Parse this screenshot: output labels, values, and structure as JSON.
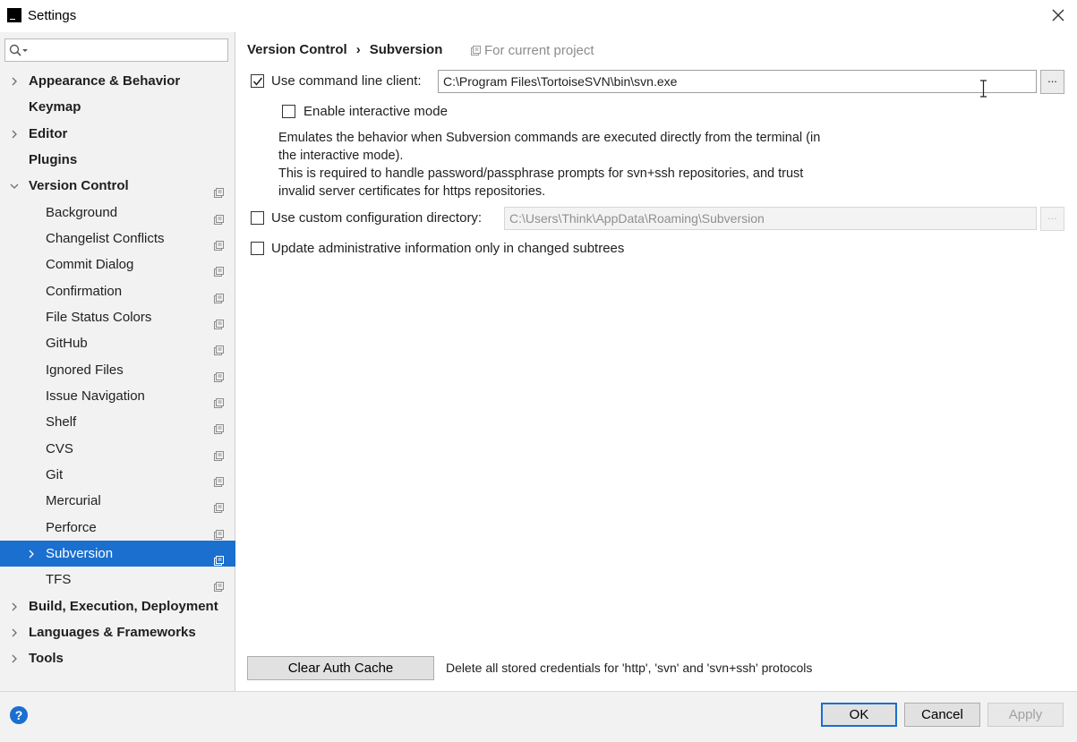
{
  "window": {
    "title": "Settings",
    "app_icon_text": "IJ"
  },
  "sidebar": {
    "search": {
      "placeholder": ""
    },
    "items": [
      {
        "label": "Appearance & Behavior",
        "bold": true,
        "level": 0,
        "arrow": "right",
        "project": false
      },
      {
        "label": "Keymap",
        "bold": true,
        "level": 0,
        "arrow": "none",
        "project": false
      },
      {
        "label": "Editor",
        "bold": true,
        "level": 0,
        "arrow": "right",
        "project": false
      },
      {
        "label": "Plugins",
        "bold": true,
        "level": 0,
        "arrow": "none",
        "project": false
      },
      {
        "label": "Version Control",
        "bold": true,
        "level": 0,
        "arrow": "down",
        "project": true
      },
      {
        "label": "Background",
        "bold": false,
        "level": 1,
        "arrow": "none",
        "project": true
      },
      {
        "label": "Changelist Conflicts",
        "bold": false,
        "level": 1,
        "arrow": "none",
        "project": true
      },
      {
        "label": "Commit Dialog",
        "bold": false,
        "level": 1,
        "arrow": "none",
        "project": true
      },
      {
        "label": "Confirmation",
        "bold": false,
        "level": 1,
        "arrow": "none",
        "project": true
      },
      {
        "label": "File Status Colors",
        "bold": false,
        "level": 1,
        "arrow": "none",
        "project": true
      },
      {
        "label": "GitHub",
        "bold": false,
        "level": 1,
        "arrow": "none",
        "project": true
      },
      {
        "label": "Ignored Files",
        "bold": false,
        "level": 1,
        "arrow": "none",
        "project": true
      },
      {
        "label": "Issue Navigation",
        "bold": false,
        "level": 1,
        "arrow": "none",
        "project": true
      },
      {
        "label": "Shelf",
        "bold": false,
        "level": 1,
        "arrow": "none",
        "project": true
      },
      {
        "label": "CVS",
        "bold": false,
        "level": 1,
        "arrow": "none",
        "project": true
      },
      {
        "label": "Git",
        "bold": false,
        "level": 1,
        "arrow": "none",
        "project": true
      },
      {
        "label": "Mercurial",
        "bold": false,
        "level": 1,
        "arrow": "none",
        "project": true
      },
      {
        "label": "Perforce",
        "bold": false,
        "level": 1,
        "arrow": "none",
        "project": true
      },
      {
        "label": "Subversion",
        "bold": false,
        "level": 1,
        "arrow": "right",
        "project": true,
        "selected": true
      },
      {
        "label": "TFS",
        "bold": false,
        "level": 1,
        "arrow": "none",
        "project": true
      },
      {
        "label": "Build, Execution, Deployment",
        "bold": true,
        "level": 0,
        "arrow": "right",
        "project": false
      },
      {
        "label": "Languages & Frameworks",
        "bold": true,
        "level": 0,
        "arrow": "right",
        "project": false
      },
      {
        "label": "Tools",
        "bold": true,
        "level": 0,
        "arrow": "right",
        "project": false
      }
    ]
  },
  "main": {
    "breadcrumb": {
      "parent": "Version Control",
      "separator": "›",
      "current": "Subversion"
    },
    "for_current_project": "For current project",
    "use_cmd_client": {
      "label": "Use command line client:",
      "checked": true,
      "value": "C:\\Program Files\\TortoiseSVN\\bin\\svn.exe",
      "browse": "..."
    },
    "interactive_mode": {
      "label": "Enable interactive mode",
      "checked": false
    },
    "description": [
      "Emulates the behavior when Subversion commands are executed directly from the terminal (in",
      "the interactive mode).",
      "This is required to handle password/passphrase prompts for svn+ssh repositories, and trust",
      "invalid server certificates for https repositories."
    ],
    "custom_config": {
      "label": "Use custom configuration directory:",
      "checked": false,
      "value": "C:\\Users\\Think\\AppData\\Roaming\\Subversion",
      "browse": "..."
    },
    "update_admin": {
      "label": "Update administrative information only in changed subtrees",
      "checked": false
    },
    "clear_auth_cache": {
      "button": "Clear Auth Cache",
      "hint": "Delete all stored credentials for 'http', 'svn' and 'svn+ssh' protocols"
    }
  },
  "footer": {
    "help": "?",
    "ok": "OK",
    "cancel": "Cancel",
    "apply": "Apply"
  },
  "colors": {
    "accent": "#1a6fcf",
    "sidebar_bg": "#f2f2f2",
    "project_icon": "#8c8c8c"
  }
}
